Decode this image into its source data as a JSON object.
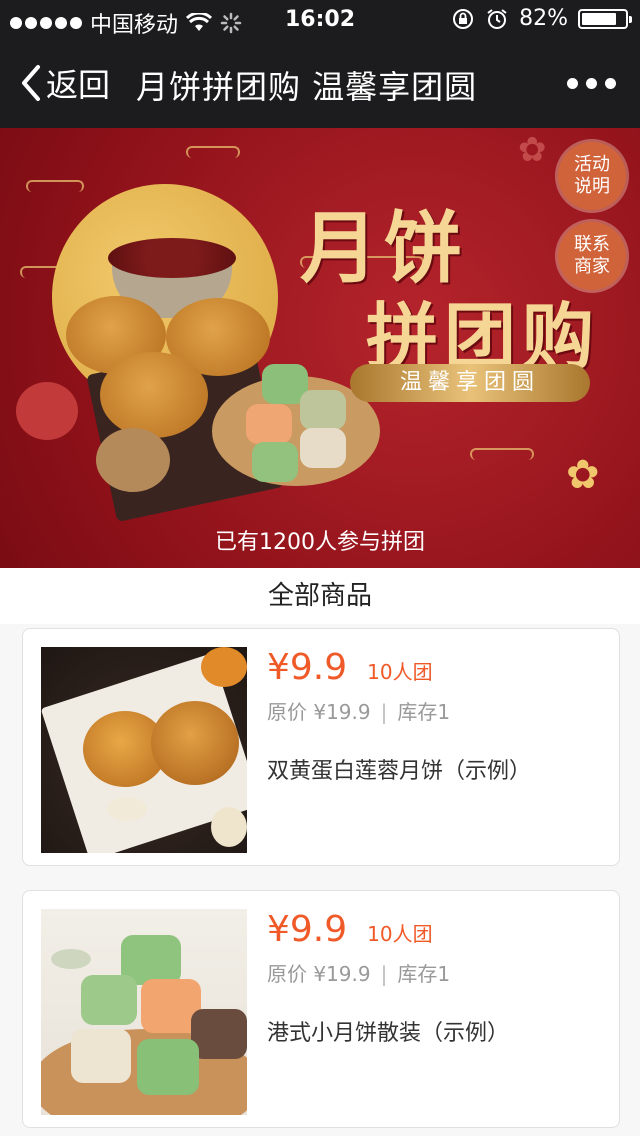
{
  "status": {
    "carrier": "中国移动",
    "time": "16:02",
    "battery": "82%",
    "battery_level": 0.82
  },
  "nav": {
    "back_label": "返回",
    "title": "月饼拼团购 温馨享团圆"
  },
  "banner": {
    "slogan_line1": "月饼",
    "slogan_line2": "拼团购",
    "subtitle": "温馨享团圆",
    "activity_button": "活动说明",
    "contact_button": "联系商家",
    "participants": "已有1200人参与拼团"
  },
  "section": {
    "title": "全部商品"
  },
  "products": [
    {
      "price": "¥9.9",
      "group": "10人团",
      "original": "原价 ¥19.9",
      "stock": "库存1",
      "name": "双黄蛋白莲蓉月饼（示例）"
    },
    {
      "price": "¥9.9",
      "group": "10人团",
      "original": "原价 ¥19.9",
      "stock": "库存1",
      "name": "港式小月饼散装（示例）"
    }
  ],
  "icons": [
    "wifi-icon",
    "loading-icon",
    "orientation-lock-icon",
    "alarm-icon",
    "battery-icon",
    "back-chevron-icon",
    "more-icon"
  ],
  "colors": {
    "accent": "#f05a28",
    "banner_red": "#9b1720",
    "gold": "#f6d695"
  }
}
